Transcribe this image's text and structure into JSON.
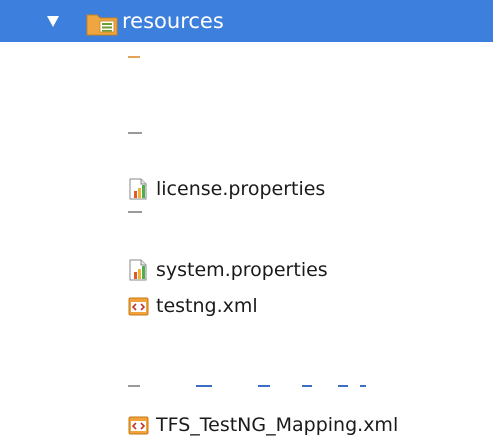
{
  "tree": {
    "folder": {
      "label": "resources",
      "icon": "resources-folder-icon",
      "expanded": true
    },
    "items": [
      {
        "label": "license.properties",
        "icon": "properties-file-icon"
      },
      {
        "label": "system.properties",
        "icon": "properties-file-icon"
      },
      {
        "label": "testng.xml",
        "icon": "xml-file-icon"
      },
      {
        "label": "TFS_TestNG_Mapping.xml",
        "icon": "xml-file-icon"
      }
    ]
  },
  "colors": {
    "selection": "#3c7fdc",
    "selection_text": "#ffffff",
    "text": "#1a1a1a",
    "folder": "#f0a640",
    "bars": [
      "#e05a2b",
      "#f3b237",
      "#4caf50"
    ]
  }
}
